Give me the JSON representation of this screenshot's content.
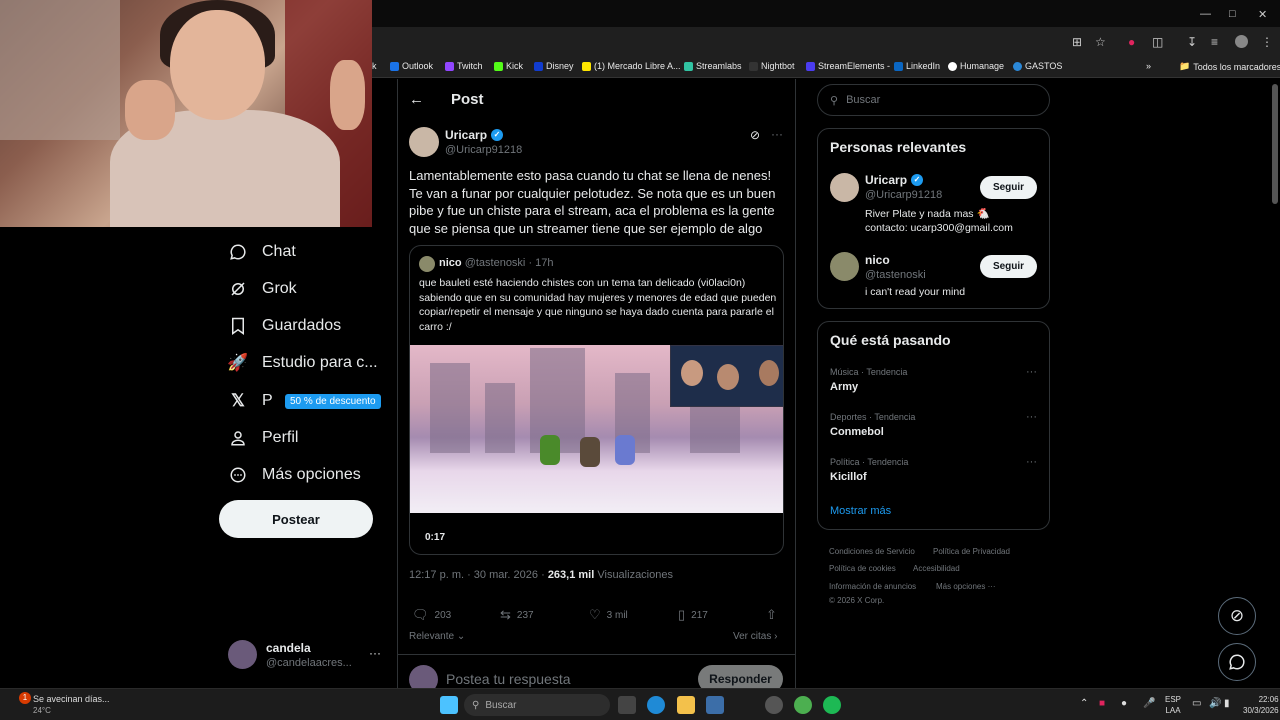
{
  "browser": {
    "bookmarks": [
      {
        "label": "k",
        "icon": "bookmark-icon"
      },
      {
        "label": "Outlook",
        "icon": "outlook-icon"
      },
      {
        "label": "Twitch",
        "icon": "twitch-icon"
      },
      {
        "label": "Kick",
        "icon": "kick-icon"
      },
      {
        "label": "Disney",
        "icon": "disney-icon"
      },
      {
        "label": "(1) Mercado Libre A...",
        "icon": "mercadolibre-icon"
      },
      {
        "label": "Streamlabs",
        "icon": "streamlabs-icon"
      },
      {
        "label": "Nightbot",
        "icon": "nightbot-icon"
      },
      {
        "label": "StreamElements -",
        "icon": "streamelements-icon"
      },
      {
        "label": "LinkedIn",
        "icon": "linkedin-icon"
      },
      {
        "label": "Humanage",
        "icon": "humanage-icon"
      },
      {
        "label": "GASTOS",
        "icon": "cloud-icon"
      }
    ],
    "all_bookmarks": "Todos los marcadores"
  },
  "sidebar": {
    "items": [
      {
        "label": "Chat",
        "icon": "chat-icon"
      },
      {
        "label": "Grok",
        "icon": "grok-icon"
      },
      {
        "label": "Guardados",
        "icon": "bookmark-icon"
      },
      {
        "label": "Estudio para c...",
        "icon": "rocket-icon"
      },
      {
        "label": "P",
        "icon": "x-logo-icon"
      },
      {
        "label": "Perfil",
        "icon": "person-icon"
      },
      {
        "label": "Más opciones",
        "icon": "more-circle-icon"
      }
    ],
    "discount_badge": "50 % de descuento",
    "post_button": "Postear",
    "account": {
      "name": "candela",
      "handle": "@candelaacres...",
      "more": "···"
    }
  },
  "main": {
    "header_title": "Post",
    "tweet": {
      "author": "Uricarp",
      "handle": "@Uricarp91218",
      "text": "Lamentablemente esto pasa cuando tu chat se llena de nenes! Te van a funar por cualquier pelotudez. Se nota que es un buen pibe y fue un chiste para el stream, aca el problema es la gente que se piensa que un streamer tiene que ser ejemplo de algo",
      "quote": {
        "author": "nico",
        "handle": "@tastenoski",
        "time": "· 17h",
        "text": "que bauleti esté haciendo chistes con un tema tan delicado (vi0laci0n) sabiendo que en su comunidad hay mujeres y menores de edad que pueden copiar/repetir el mensaje y que ninguno se haya dado cuenta para pararle el carro :/",
        "video_duration": "0:17"
      },
      "timestamp": "12:17 p. m. · 30 mar. 2026 ·",
      "views_count": "263,1 mil",
      "views_label": "Visualizaciones",
      "replies": "203",
      "retweets": "237",
      "likes": "3 mil",
      "bookmarks": "217",
      "sort_label": "Relevante",
      "quotes_link": "Ver citas"
    },
    "reply_placeholder": "Postea tu respuesta",
    "reply_button": "Responder"
  },
  "right": {
    "search_placeholder": "Buscar",
    "relevant_title": "Personas relevantes",
    "people": [
      {
        "name": "Uricarp",
        "handle": "@Uricarp91218",
        "bio": "River Plate y nada mas 🐔\ncontacto: ucarp300@gmail.com",
        "button": "Seguir"
      },
      {
        "name": "nico",
        "handle": "@tastenoski",
        "bio": "i can't read your mind",
        "button": "Seguir"
      }
    ],
    "trends_title": "Qué está pasando",
    "trends": [
      {
        "category": "Música · Tendencia",
        "name": "Army"
      },
      {
        "category": "Deportes · Tendencia",
        "name": "Conmebol"
      },
      {
        "category": "Política · Tendencia",
        "name": "Kicillof"
      }
    ],
    "show_more": "Mostrar más",
    "footer": [
      "Condiciones de Servicio",
      "Política de Privacidad",
      "Política de cookies",
      "Accesibilidad",
      "Información de anuncios",
      "Más opciones ···",
      "© 2026 X Corp."
    ]
  },
  "taskbar": {
    "weather_title": "Se avecinan días...",
    "weather_temp": "24°C",
    "search_placeholder": "Buscar",
    "lang": "ESP",
    "lang2": "LAA",
    "time": "22:06",
    "date": "30/3/2026"
  },
  "colors": {
    "accent": "#1d9bf0",
    "background": "#000000",
    "border": "#2f3336"
  }
}
